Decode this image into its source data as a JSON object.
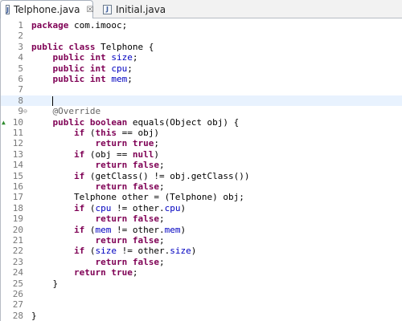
{
  "tabs": [
    {
      "label": "Telphone.java",
      "icon": "java-file-icon",
      "active": true,
      "close_glyph": "☒"
    },
    {
      "label": "Initial.java",
      "icon": "java-file-icon",
      "active": false
    }
  ],
  "colors": {
    "keyword": "#7f0055",
    "field": "#0000c0",
    "annotation": "#646464",
    "current_line": "#e8f2fe"
  },
  "lines": [
    {
      "n": "1",
      "tokens": [
        {
          "t": "package ",
          "c": "kw"
        },
        {
          "t": "com.imooc;",
          "c": ""
        }
      ]
    },
    {
      "n": "2",
      "tokens": []
    },
    {
      "n": "3",
      "tokens": [
        {
          "t": "public class ",
          "c": "kw"
        },
        {
          "t": "Telphone {",
          "c": ""
        }
      ]
    },
    {
      "n": "4",
      "tokens": [
        {
          "t": "    "
        },
        {
          "t": "public int ",
          "c": "kw"
        },
        {
          "t": "size",
          "c": "fld"
        },
        {
          "t": ";"
        }
      ]
    },
    {
      "n": "5",
      "tokens": [
        {
          "t": "    "
        },
        {
          "t": "public int ",
          "c": "kw"
        },
        {
          "t": "cpu",
          "c": "fld"
        },
        {
          "t": ";"
        }
      ]
    },
    {
      "n": "6",
      "tokens": [
        {
          "t": "    "
        },
        {
          "t": "public int ",
          "c": "kw"
        },
        {
          "t": "mem",
          "c": "fld"
        },
        {
          "t": ";"
        }
      ]
    },
    {
      "n": "7",
      "tokens": []
    },
    {
      "n": "8",
      "tokens": [],
      "current": true
    },
    {
      "n": "9",
      "tokens": [
        {
          "t": "    "
        },
        {
          "t": "@Override",
          "c": "ann"
        }
      ],
      "marker": "⊖"
    },
    {
      "n": "10",
      "tokens": [
        {
          "t": "    "
        },
        {
          "t": "public boolean ",
          "c": "kw"
        },
        {
          "t": "equals(Object obj) {"
        }
      ],
      "override": "▲"
    },
    {
      "n": "11",
      "tokens": [
        {
          "t": "        "
        },
        {
          "t": "if ",
          "c": "kw"
        },
        {
          "t": "("
        },
        {
          "t": "this",
          "c": "kw"
        },
        {
          "t": " == obj)"
        }
      ]
    },
    {
      "n": "12",
      "tokens": [
        {
          "t": "            "
        },
        {
          "t": "return true",
          "c": "kw"
        },
        {
          "t": ";"
        }
      ]
    },
    {
      "n": "13",
      "tokens": [
        {
          "t": "        "
        },
        {
          "t": "if ",
          "c": "kw"
        },
        {
          "t": "(obj == "
        },
        {
          "t": "null",
          "c": "kw"
        },
        {
          "t": ")"
        }
      ]
    },
    {
      "n": "14",
      "tokens": [
        {
          "t": "            "
        },
        {
          "t": "return false",
          "c": "kw"
        },
        {
          "t": ";"
        }
      ]
    },
    {
      "n": "15",
      "tokens": [
        {
          "t": "        "
        },
        {
          "t": "if ",
          "c": "kw"
        },
        {
          "t": "(getClass() != obj.getClass())"
        }
      ]
    },
    {
      "n": "16",
      "tokens": [
        {
          "t": "            "
        },
        {
          "t": "return false",
          "c": "kw"
        },
        {
          "t": ";"
        }
      ]
    },
    {
      "n": "17",
      "tokens": [
        {
          "t": "        Telphone other = (Telphone) obj;"
        }
      ]
    },
    {
      "n": "18",
      "tokens": [
        {
          "t": "        "
        },
        {
          "t": "if ",
          "c": "kw"
        },
        {
          "t": "("
        },
        {
          "t": "cpu",
          "c": "fld"
        },
        {
          "t": " != other."
        },
        {
          "t": "cpu",
          "c": "fld"
        },
        {
          "t": ")"
        }
      ]
    },
    {
      "n": "19",
      "tokens": [
        {
          "t": "            "
        },
        {
          "t": "return false",
          "c": "kw"
        },
        {
          "t": ";"
        }
      ]
    },
    {
      "n": "20",
      "tokens": [
        {
          "t": "        "
        },
        {
          "t": "if ",
          "c": "kw"
        },
        {
          "t": "("
        },
        {
          "t": "mem",
          "c": "fld"
        },
        {
          "t": " != other."
        },
        {
          "t": "mem",
          "c": "fld"
        },
        {
          "t": ")"
        }
      ]
    },
    {
      "n": "21",
      "tokens": [
        {
          "t": "            "
        },
        {
          "t": "return false",
          "c": "kw"
        },
        {
          "t": ";"
        }
      ]
    },
    {
      "n": "22",
      "tokens": [
        {
          "t": "        "
        },
        {
          "t": "if ",
          "c": "kw"
        },
        {
          "t": "("
        },
        {
          "t": "size",
          "c": "fld"
        },
        {
          "t": " != other."
        },
        {
          "t": "size",
          "c": "fld"
        },
        {
          "t": ")"
        }
      ]
    },
    {
      "n": "23",
      "tokens": [
        {
          "t": "            "
        },
        {
          "t": "return false",
          "c": "kw"
        },
        {
          "t": ";"
        }
      ]
    },
    {
      "n": "24",
      "tokens": [
        {
          "t": "        "
        },
        {
          "t": "return true",
          "c": "kw"
        },
        {
          "t": ";"
        }
      ]
    },
    {
      "n": "25",
      "tokens": [
        {
          "t": "    }"
        }
      ]
    },
    {
      "n": "26",
      "tokens": []
    },
    {
      "n": "27",
      "tokens": []
    },
    {
      "n": "28",
      "tokens": [
        {
          "t": "}"
        }
      ]
    }
  ]
}
